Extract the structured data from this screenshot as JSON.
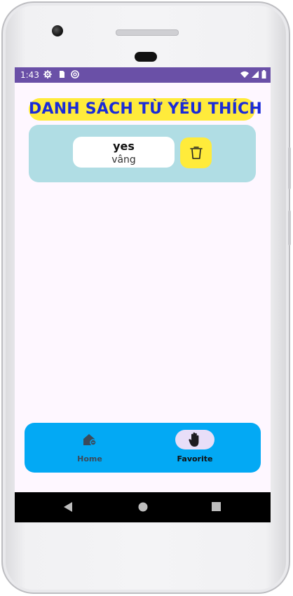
{
  "status_bar": {
    "time": "1:43"
  },
  "page": {
    "title": "DANH SÁCH TỪ YÊU THÍCH"
  },
  "favorites": [
    {
      "word": "yes",
      "meaning": "vâng"
    }
  ],
  "bottom_nav": {
    "items": [
      {
        "label": "Home",
        "icon": "home-icon",
        "selected": false
      },
      {
        "label": "Favorite",
        "icon": "hand-icon",
        "selected": true
      }
    ]
  },
  "colors": {
    "status_bar": "#6a50a7",
    "title_bg": "#ffeb3b",
    "title_text": "#1a2bd8",
    "card_bg": "#b0dde4",
    "nav_bg": "#03a9f4",
    "nav_selected_pill": "#e8def8"
  }
}
